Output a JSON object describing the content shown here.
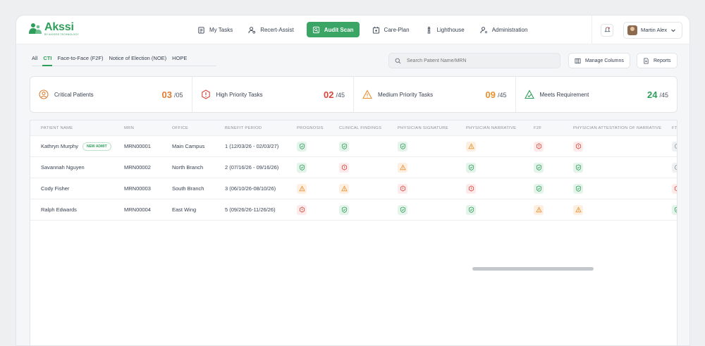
{
  "app": {
    "name": "Akssi",
    "tagline": "BY AXXESS TECHNOLOGY",
    "brand_color": "#2f9e5a"
  },
  "nav": [
    {
      "label": "My Tasks",
      "icon": "clipboard-icon",
      "active": false
    },
    {
      "label": "Recert-Assist",
      "icon": "user-gear-icon",
      "active": false
    },
    {
      "label": "Audit Scan",
      "icon": "scan-icon",
      "active": true
    },
    {
      "label": "Care-Plan",
      "icon": "calendar-plus-icon",
      "active": false
    },
    {
      "label": "Lighthouse",
      "icon": "lighthouse-icon",
      "active": false
    },
    {
      "label": "Administration",
      "icon": "user-settings-icon",
      "active": false
    }
  ],
  "user": {
    "name": "Martin Alex"
  },
  "tabs": [
    {
      "label": "All",
      "active": false
    },
    {
      "label": "CTI",
      "active": true
    },
    {
      "label": "Face-to-Face (F2F)",
      "active": false
    },
    {
      "label": "Notice of Election (NOE)",
      "active": false
    },
    {
      "label": "HOPE",
      "active": false
    }
  ],
  "search": {
    "placeholder": "Search Patient Name/MRN"
  },
  "buttons": {
    "manage_columns": "Manage Columns",
    "reports": "Reports"
  },
  "stats": [
    {
      "label": "Critical Patients",
      "value": "03",
      "total": "/05",
      "color": "#e07b2f",
      "icon": "user-circle-icon"
    },
    {
      "label": "High Priority Tasks",
      "value": "02",
      "total": "/45",
      "color": "#d9453b",
      "icon": "hexagon-alert-icon"
    },
    {
      "label": "Medium Priority Tasks",
      "value": "09",
      "total": "/45",
      "color": "#e8912f",
      "icon": "triangle-alert-icon"
    },
    {
      "label": "Meets Requirement",
      "value": "24",
      "total": "/45",
      "color": "#2f9e5a",
      "icon": "triangle-check-icon"
    }
  ],
  "table": {
    "columns": [
      "PATIENT NAME",
      "MRN",
      "OFFICE",
      "BENEFIT PERIOD",
      "PROGNOSIS",
      "CLINICAL FINDINGS",
      "PHYSICIAN SIGNATURE",
      "PHYSICIAN NARRATIVE",
      "F2F",
      "PHYSICIAN ATTESTATION OF NARRATIVE",
      "FT"
    ],
    "rows": [
      {
        "name": "Kathryn Murphy",
        "badge": "NEW ADMIT",
        "mrn": "MRN00001",
        "office": "Main Campus",
        "period": "1 (12/03/26 - 02/03/27)",
        "statuses": [
          "ok",
          "ok",
          "ok",
          "warn",
          "err",
          "err",
          "gray"
        ]
      },
      {
        "name": "Savannah Nguyen",
        "badge": "",
        "mrn": "MRN00002",
        "office": "North Branch",
        "period": "2 (07/16/26 - 09/16/26)",
        "statuses": [
          "ok",
          "err",
          "warn",
          "ok",
          "ok",
          "ok",
          "gray"
        ]
      },
      {
        "name": "Cody Fisher",
        "badge": "",
        "mrn": "MRN00003",
        "office": "South Branch",
        "period": "3 (06/10/26-08/10/26)",
        "statuses": [
          "warn",
          "warn",
          "err",
          "err",
          "ok",
          "ok",
          "err"
        ]
      },
      {
        "name": "Ralph Edwards",
        "badge": "",
        "mrn": "MRN00004",
        "office": "East Wing",
        "period": "5 (09/26/26-11/26/26)",
        "statuses": [
          "err",
          "ok",
          "ok",
          "ok",
          "warn",
          "warn",
          "ok"
        ]
      }
    ]
  },
  "status_colors": {
    "ok": "#2f9e5a",
    "warn": "#e8912f",
    "err": "#d9453b",
    "gray": "#8a929b"
  }
}
